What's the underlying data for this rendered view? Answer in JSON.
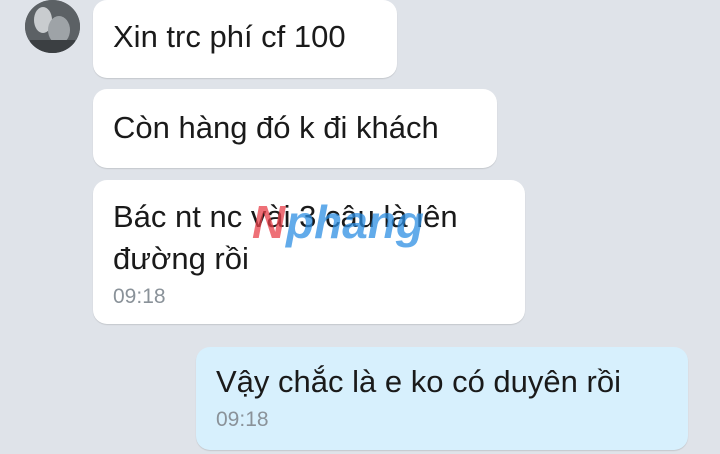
{
  "messages": [
    {
      "direction": "incoming",
      "text": "Xin trc phí cf 100"
    },
    {
      "direction": "incoming",
      "text": "Còn hàng đó k đi khách"
    },
    {
      "direction": "incoming",
      "text": "Bác nt nc vài 3 câu là lên đường rồi",
      "time": "09:18"
    },
    {
      "direction": "outgoing",
      "text": "Vậy chắc là e ko có duyên rồi",
      "time": "09:18"
    }
  ],
  "watermark": {
    "text": "Nphang",
    "colors": [
      "#e8404a",
      "#2d8fe3"
    ]
  },
  "colors": {
    "background": "#dfe3e9",
    "incoming_bubble": "#ffffff",
    "outgoing_bubble": "#d7f0fd"
  }
}
